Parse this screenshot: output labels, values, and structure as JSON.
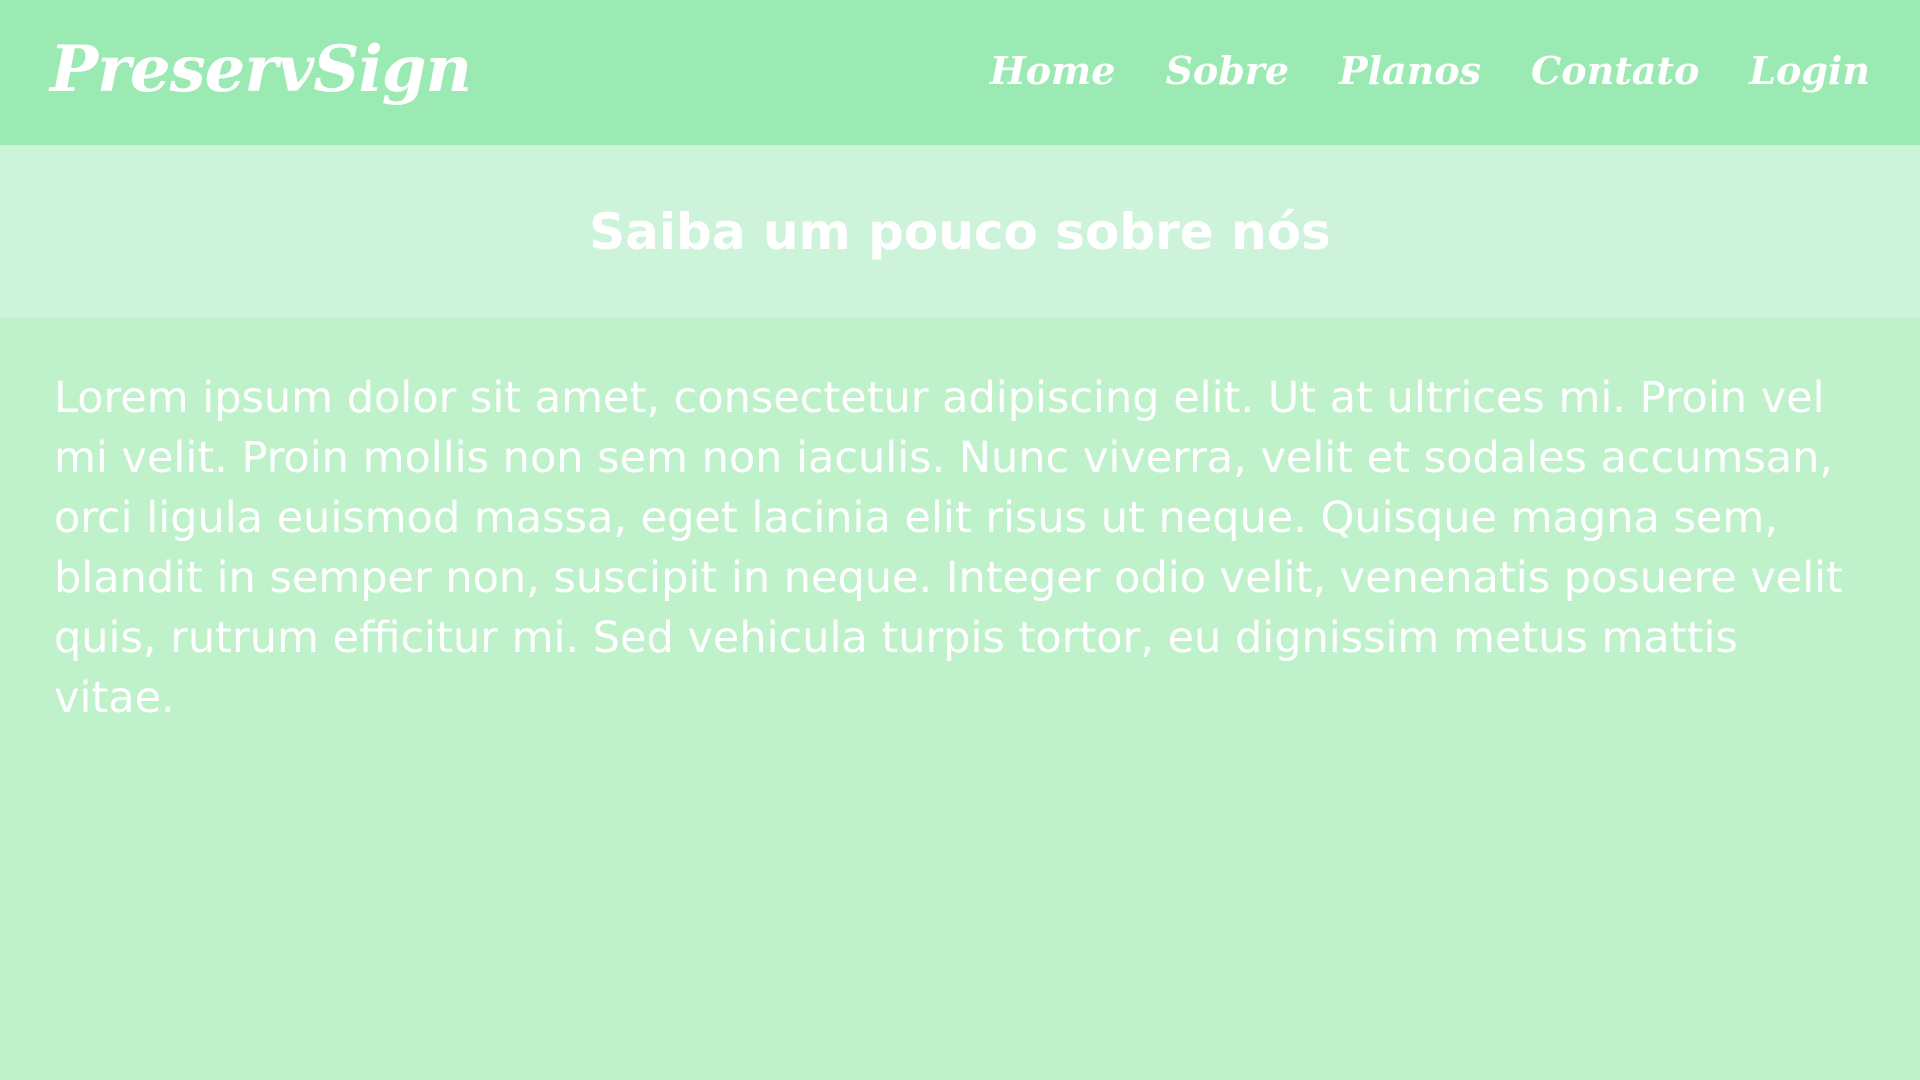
{
  "brand": {
    "name": "PreservSign"
  },
  "nav": {
    "items": [
      {
        "label": "Home"
      },
      {
        "label": "Sobre"
      },
      {
        "label": "Planos"
      },
      {
        "label": "Contato"
      },
      {
        "label": "Login"
      }
    ]
  },
  "hero": {
    "title": "Saiba um pouco sobre nós"
  },
  "content": {
    "paragraph": "Lorem ipsum dolor sit amet, consectetur adipiscing elit. Ut at ultrices mi. Proin vel mi velit. Proin mollis non sem non iaculis. Nunc viverra, velit et sodales accumsan, orci ligula euismod massa, eget lacinia elit risus ut neque. Quisque magna sem, blandit in semper non, suscipit in neque. Integer odio velit, venenatis posuere velit quis, rutrum efficitur mi. Sed vehicula turpis tortor, eu dignissim metus mattis vitae."
  },
  "colors": {
    "navbar_bg": "#9ceab3",
    "hero_bg": "#cdf4da",
    "content_bg": "#bff1cb",
    "text": "#ffffff"
  }
}
